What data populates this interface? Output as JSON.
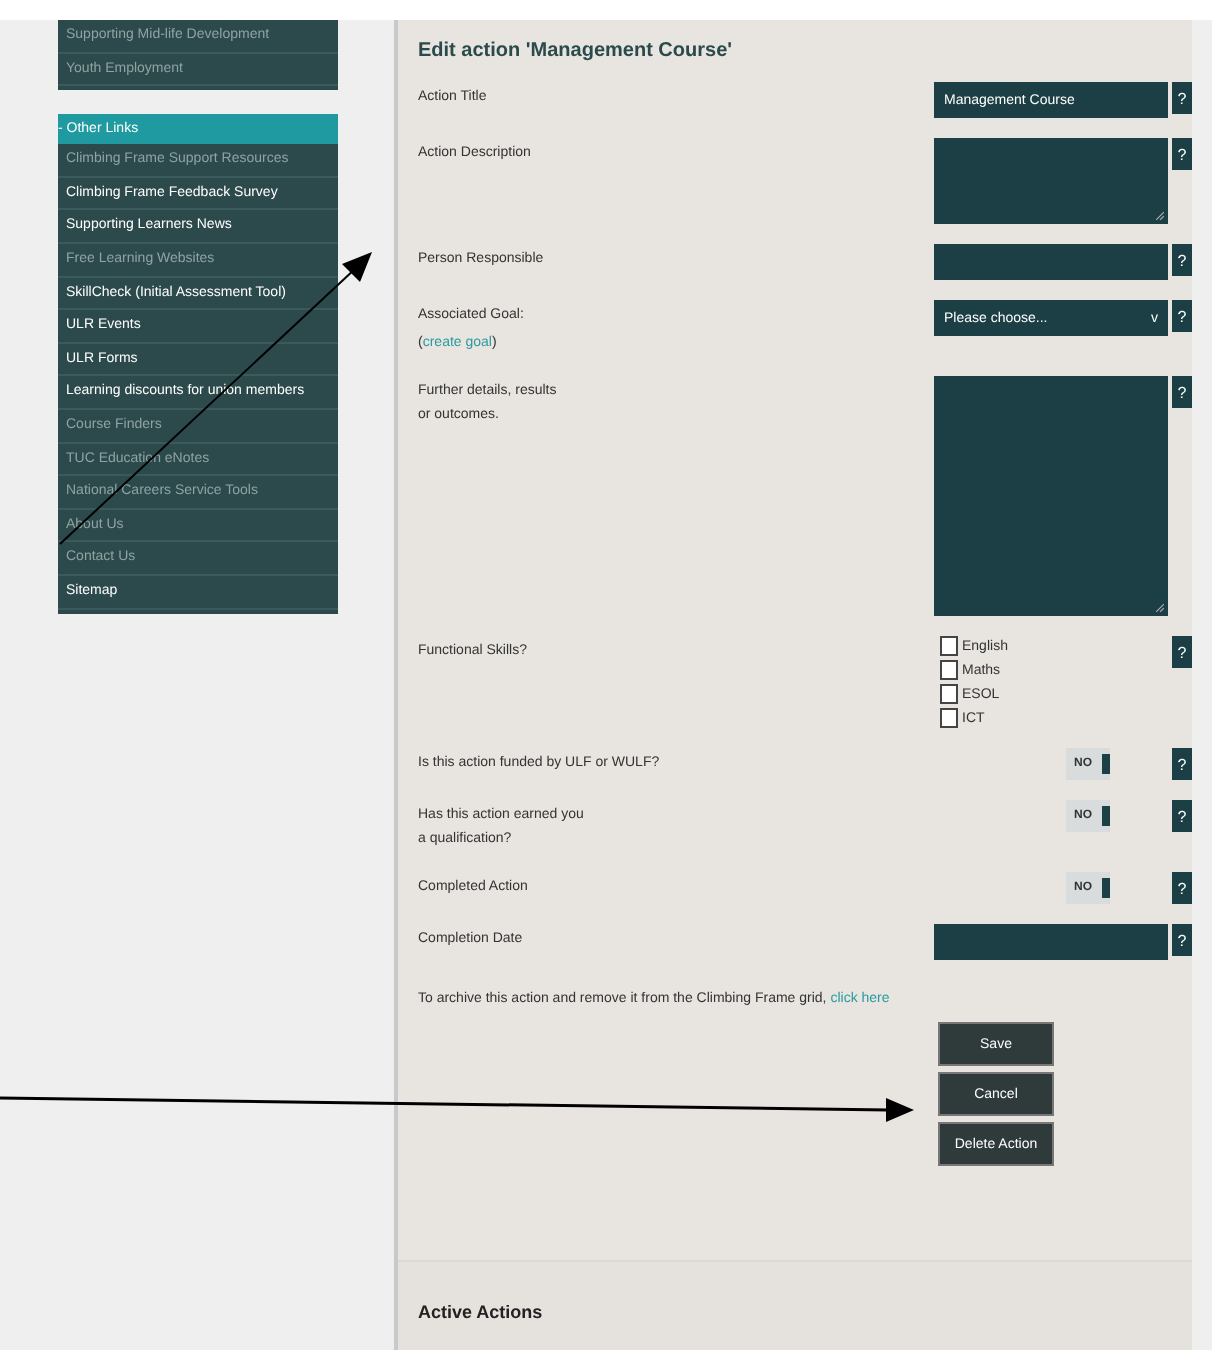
{
  "sidebar": {
    "panels": [
      {
        "items": [
          {
            "label": "Supporting Mid-life Development",
            "bright": false
          },
          {
            "label": "Youth Employment",
            "bright": false
          }
        ]
      },
      {
        "header": "- Other Links",
        "items": [
          {
            "label": "Climbing Frame Support Resources",
            "bright": false
          },
          {
            "label": "Climbing Frame Feedback Survey",
            "bright": true
          },
          {
            "label": "Supporting Learners News",
            "bright": true
          },
          {
            "label": "Free Learning Websites",
            "bright": false
          },
          {
            "label": "SkillCheck (Initial Assessment Tool)",
            "bright": true
          },
          {
            "label": "ULR Events",
            "bright": true
          },
          {
            "label": "ULR Forms",
            "bright": true
          },
          {
            "label": "Learning discounts for union members",
            "bright": true
          },
          {
            "label": "Course Finders",
            "bright": false
          },
          {
            "label": "TUC Education eNotes",
            "bright": false
          },
          {
            "label": "National Careers Service Tools",
            "bright": false
          },
          {
            "label": "About Us",
            "bright": false
          },
          {
            "label": "Contact Us",
            "bright": false
          },
          {
            "label": "Sitemap",
            "bright": true
          }
        ]
      }
    ]
  },
  "form": {
    "title": "Edit action 'Management Course'",
    "rows": [
      {
        "kind": "text",
        "label": "Action Title",
        "value": "Management Course",
        "help": "?"
      },
      {
        "kind": "textarea",
        "label": "Action Description",
        "help": "?"
      },
      {
        "kind": "text",
        "label": "Person Responsible",
        "help": "?"
      },
      {
        "kind": "select",
        "label": "Associated Goal:",
        "link_before": "(",
        "link": "create goal",
        "link_after": ")",
        "value": "Please choose...",
        "caret": "v",
        "help": "?"
      },
      {
        "kind": "notes",
        "label": "Further details, results\nor outcomes.",
        "help": "?"
      },
      {
        "kind": "checkboxes",
        "label": "Functional Skills?",
        "options": [
          {
            "label": "English",
            "checked": false
          },
          {
            "label": "Maths",
            "checked": false
          },
          {
            "label": "ESOL",
            "checked": false
          },
          {
            "label": "ICT",
            "checked": false
          }
        ],
        "help": "?"
      },
      {
        "kind": "toggle",
        "label": "Is this action funded by ULF or WULF?",
        "value": "NO",
        "on": false,
        "help": "?"
      },
      {
        "kind": "toggle",
        "label": "Has this action earned you\na qualification?",
        "value": "NO",
        "on": false,
        "help": "?"
      },
      {
        "kind": "toggle",
        "label": "Completed Action",
        "value": "NO",
        "on": false,
        "help": "?"
      },
      {
        "kind": "text",
        "label": "Completion Date",
        "help": "?"
      }
    ],
    "archive": {
      "text": "To archive this action and remove it from the Climbing Frame grid, ",
      "link": "click here"
    },
    "buttons": [
      "Save",
      "Cancel",
      "Delete Action"
    ]
  },
  "section": {
    "title": "Active Actions"
  }
}
